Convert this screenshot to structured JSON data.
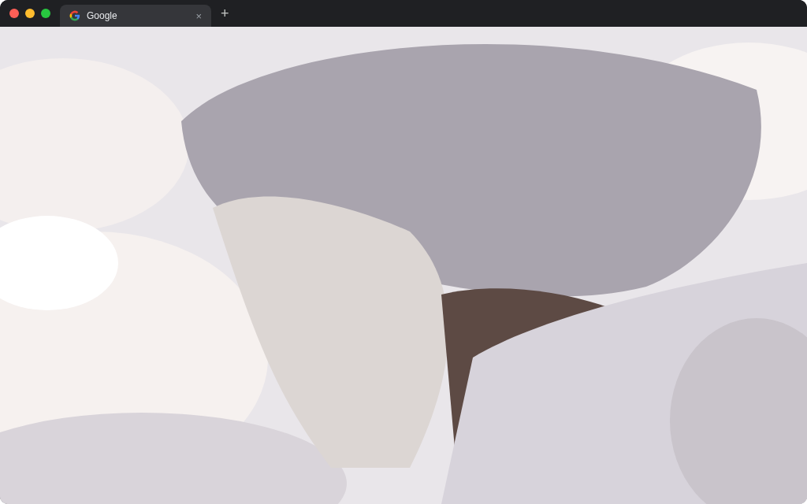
{
  "window_controls": [
    {
      "kind": "close"
    },
    {
      "kind": "minimize"
    },
    {
      "kind": "maximize"
    }
  ],
  "tabs": [
    {
      "title": "Google",
      "selected": true,
      "close": "×"
    }
  ],
  "new_tab": "+"
}
